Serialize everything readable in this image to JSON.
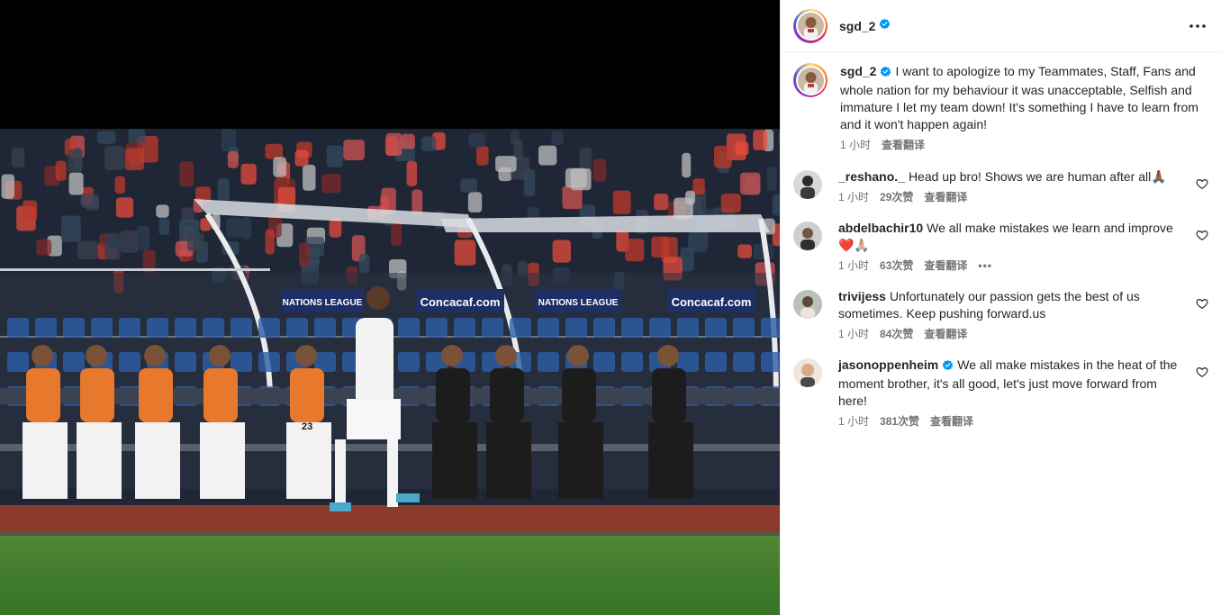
{
  "post": {
    "username": "sgd_2",
    "caption": "I want to apologize to my Teammates, Staff, Fans and whole nation for my behaviour it was unacceptable, Selfish and immature I let my team down! It's something I have to learn from and it won't happen again!",
    "time": "1 小时",
    "translate_label": "查看翻译"
  },
  "photo_banners": {
    "nations_league": "NATIONS LEAGUE",
    "concacaf_small": "Concacaf",
    "concacaf_com": "Concacaf.com",
    "shirt_number": "23"
  },
  "comments": [
    {
      "username": "_reshano._",
      "text": "Head up bro! Shows we are human after all🙏🏾",
      "time": "1 小时",
      "likes": "29次赞",
      "translate": "查看翻译",
      "verified": false,
      "more": ""
    },
    {
      "username": "abdelbachir10",
      "text": "We all make mistakes we learn and improve❤️🙏🏼",
      "time": "1 小时",
      "likes": "63次赞",
      "translate": "查看翻译",
      "verified": false,
      "more": "•••"
    },
    {
      "username": "trivijess",
      "text": "Unfortunately our passion gets the best of us sometimes. Keep pushing forward.us",
      "time": "1 小时",
      "likes": "84次赞",
      "translate": "查看翻译",
      "verified": false,
      "more": ""
    },
    {
      "username": "jasonoppenheim",
      "text": "We all make mistakes in the heat of the moment brother, it's all good, let's just move forward from here!",
      "time": "1 小时",
      "likes": "381次赞",
      "translate": "查看翻译",
      "verified": true,
      "more": ""
    }
  ],
  "colors": {
    "verified_blue": "#0095f6",
    "meta_gray": "#737373",
    "text_dark": "#262626",
    "pitch_green": "#3f7a2a",
    "track_red": "#8a3b2c",
    "seat_blue": "#2d5ea8",
    "bib_orange": "#e8782b"
  },
  "icons": {
    "more": "more-horizontal-icon",
    "like": "heart-outline-icon",
    "verified": "verified-badge-icon"
  }
}
